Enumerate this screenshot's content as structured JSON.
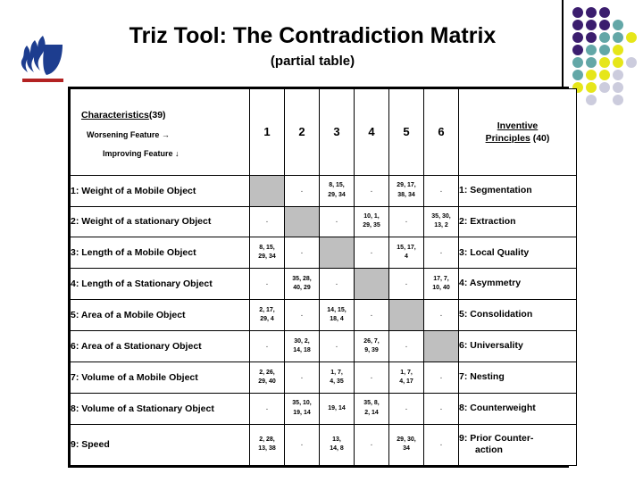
{
  "slide": {
    "title": "Triz Tool: The Contradiction Matrix",
    "subtitle": "(partial table)",
    "logo_name": "georgia-state-flame-logo"
  },
  "decor": {
    "colors": {
      "purple": "#3b1d6e",
      "teal": "#63a7a7",
      "yellow": "#e6e619",
      "lavender": "#ccccdd"
    },
    "dots": [
      {
        "col": 0,
        "row": 0,
        "color": "#3b1d6e"
      },
      {
        "col": 1,
        "row": 0,
        "color": "#3b1d6e"
      },
      {
        "col": 2,
        "row": 0,
        "color": "#3b1d6e"
      },
      {
        "col": 0,
        "row": 1,
        "color": "#3b1d6e"
      },
      {
        "col": 1,
        "row": 1,
        "color": "#3b1d6e"
      },
      {
        "col": 2,
        "row": 1,
        "color": "#3b1d6e"
      },
      {
        "col": 3,
        "row": 1,
        "color": "#63a7a7"
      },
      {
        "col": 0,
        "row": 2,
        "color": "#3b1d6e"
      },
      {
        "col": 1,
        "row": 2,
        "color": "#3b1d6e"
      },
      {
        "col": 2,
        "row": 2,
        "color": "#63a7a7"
      },
      {
        "col": 3,
        "row": 2,
        "color": "#63a7a7"
      },
      {
        "col": 4,
        "row": 2,
        "color": "#e6e619"
      },
      {
        "col": 0,
        "row": 3,
        "color": "#3b1d6e"
      },
      {
        "col": 1,
        "row": 3,
        "color": "#63a7a7"
      },
      {
        "col": 2,
        "row": 3,
        "color": "#63a7a7"
      },
      {
        "col": 3,
        "row": 3,
        "color": "#e6e619"
      },
      {
        "col": 0,
        "row": 4,
        "color": "#63a7a7"
      },
      {
        "col": 1,
        "row": 4,
        "color": "#63a7a7"
      },
      {
        "col": 2,
        "row": 4,
        "color": "#e6e619"
      },
      {
        "col": 3,
        "row": 4,
        "color": "#e6e619"
      },
      {
        "col": 4,
        "row": 4,
        "color": "#ccccdd"
      },
      {
        "col": 0,
        "row": 5,
        "color": "#63a7a7"
      },
      {
        "col": 1,
        "row": 5,
        "color": "#e6e619"
      },
      {
        "col": 2,
        "row": 5,
        "color": "#e6e619"
      },
      {
        "col": 3,
        "row": 5,
        "color": "#ccccdd"
      },
      {
        "col": 0,
        "row": 6,
        "color": "#e6e619"
      },
      {
        "col": 1,
        "row": 6,
        "color": "#e6e619"
      },
      {
        "col": 2,
        "row": 6,
        "color": "#ccccdd"
      },
      {
        "col": 3,
        "row": 6,
        "color": "#ccccdd"
      },
      {
        "col": 1,
        "row": 7,
        "color": "#ccccdd"
      },
      {
        "col": 3,
        "row": 7,
        "color": "#ccccdd"
      }
    ]
  },
  "table": {
    "header": {
      "characteristics_label": "Characteristics",
      "characteristics_count": "(39)",
      "worsening_feature": "Worsening Feature →",
      "improving_feature": "Improving Feature ↓",
      "principles_label_line1": "Inventive",
      "principles_label_line2": "Principles",
      "principles_count": "(40)",
      "column_numbers": [
        "1",
        "2",
        "3",
        "4",
        "5",
        "6"
      ]
    },
    "rows": [
      {
        "label": "1: Weight of a Mobile Object",
        "cells": [
          "",
          ".",
          "8, 15,\n29, 34",
          ".",
          "29, 17,\n38, 34",
          "."
        ],
        "gray_index": 0,
        "principle": "1:  Segmentation"
      },
      {
        "label": "2: Weight of a stationary Object",
        "cells": [
          ".",
          "",
          ".",
          "10, 1,\n29, 35",
          ".",
          "35, 30,\n13, 2"
        ],
        "gray_index": 1,
        "principle": "2: Extraction"
      },
      {
        "label": "3: Length of a Mobile Object",
        "cells": [
          "8, 15,\n29, 34",
          ".",
          "",
          ".",
          "15, 17,\n4",
          "."
        ],
        "gray_index": 2,
        "principle": "3: Local Quality"
      },
      {
        "label": "4: Length of a Stationary Object",
        "cells": [
          ".",
          "35, 28,\n40, 29",
          ".",
          "",
          ".",
          "17, 7,\n10, 40"
        ],
        "gray_index": 3,
        "principle": "4: Asymmetry"
      },
      {
        "label": "5: Area of a Mobile Object",
        "cells": [
          "2, 17,\n29, 4",
          ".",
          "14, 15,\n18, 4",
          ".",
          "",
          "."
        ],
        "gray_index": 4,
        "principle": "5: Consolidation"
      },
      {
        "label": "6: Area of a Stationary Object",
        "cells": [
          ".",
          "30, 2,\n14, 18",
          ".",
          "26, 7,\n9, 39",
          ".",
          ""
        ],
        "gray_index": 5,
        "principle": "6: Universality"
      },
      {
        "label": "7: Volume of a Mobile Object",
        "cells": [
          "2, 26,\n29, 40",
          ".",
          "1, 7,\n4, 35",
          ".",
          "1, 7,\n4, 17",
          "."
        ],
        "gray_index": -1,
        "principle": "7: Nesting"
      },
      {
        "label": "8: Volume of a Stationary Object",
        "cells": [
          ".",
          "35, 10,\n19, 14",
          "19, 14",
          "35, 8,\n2, 14",
          ".",
          "."
        ],
        "gray_index": -1,
        "principle": "8: Counterweight"
      },
      {
        "label": "9: Speed",
        "cells": [
          "2, 28,\n13, 38",
          ".",
          "13,\n14, 8",
          ".",
          "29, 30,\n34",
          "."
        ],
        "gray_index": -1,
        "principle": "9: Prior Counter-",
        "principle_line2": "action"
      }
    ]
  }
}
